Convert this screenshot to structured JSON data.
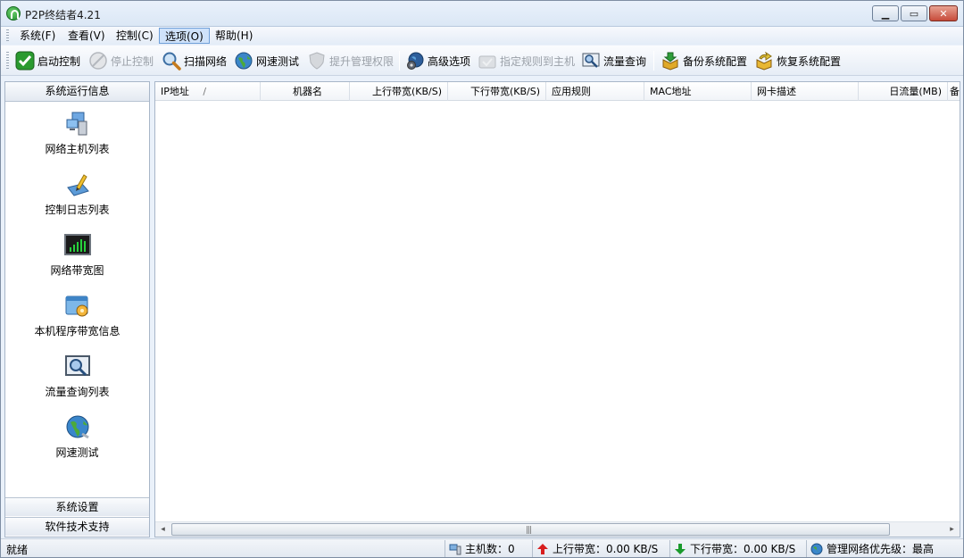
{
  "window": {
    "title": "P2P终结者4.21",
    "controls": [
      "minimize",
      "maximize",
      "close"
    ]
  },
  "menu": [
    {
      "label": "系统(F)",
      "active": false
    },
    {
      "label": "查看(V)",
      "active": false
    },
    {
      "label": "控制(C)",
      "active": false
    },
    {
      "label": "选项(O)",
      "active": true
    },
    {
      "label": "帮助(H)",
      "active": false
    }
  ],
  "toolbar": {
    "start_control": "启动控制",
    "stop_control": "停止控制",
    "scan_network": "扫描网络",
    "speed_test": "网速测试",
    "elevate_privilege": "提升管理权限",
    "advanced_options": "高级选项",
    "assign_rules": "指定规则到主机",
    "traffic_query": "流量查询",
    "backup_config": "备份系统配置",
    "restore_config": "恢复系统配置"
  },
  "sidebar": {
    "header": "系统运行信息",
    "items": [
      {
        "label": "网络主机列表",
        "icon": "network-hosts-icon"
      },
      {
        "label": "控制日志列表",
        "icon": "control-log-icon"
      },
      {
        "label": "网络带宽图",
        "icon": "bandwidth-chart-icon"
      },
      {
        "label": "本机程序带宽信息",
        "icon": "local-program-bandwidth-icon"
      },
      {
        "label": "流量查询列表",
        "icon": "traffic-query-icon"
      },
      {
        "label": "网速测试",
        "icon": "speed-test-icon"
      }
    ],
    "footer": [
      "系统设置",
      "软件技术支持"
    ]
  },
  "list": {
    "columns": [
      "IP地址",
      "机器名",
      "上行带宽(KB/S)",
      "下行带宽(KB/S)",
      "应用规则",
      "MAC地址",
      "网卡描述",
      "日流量(MB)",
      "备"
    ],
    "sort_indicator": "/",
    "rows": []
  },
  "scrollbar": {
    "left_arrow": "◂",
    "right_arrow": "▸",
    "grip": "|||"
  },
  "status": {
    "ready": "就绪",
    "hosts": "主机数：0",
    "upload": "上行带宽：0.00 KB/S",
    "download": "下行带宽：0.00 KB/S",
    "priority": "管理网络优先级：最高"
  },
  "colors": {
    "window_bg": "#eaf1fa",
    "active_menu": "#cfe2fa",
    "upload_arrow": "#d81e1e",
    "download_arrow": "#1a9a2c"
  }
}
